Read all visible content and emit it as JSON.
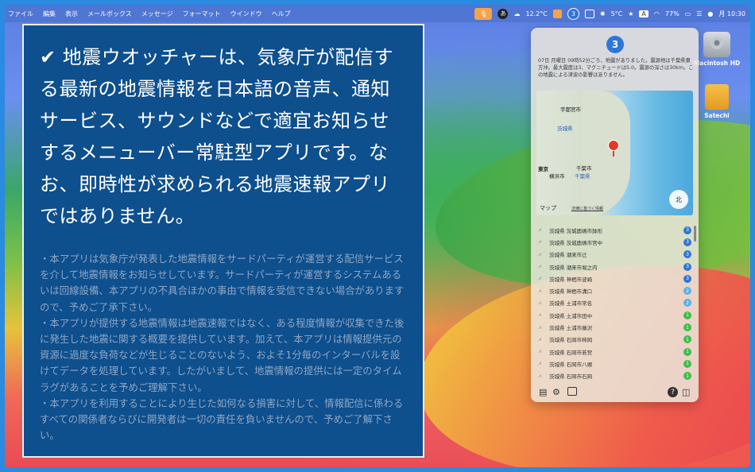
{
  "menubar": {
    "items": [
      "ファイル",
      "編集",
      "表示",
      "メールボックス",
      "メッセージ",
      "フォーマット",
      "ウインドウ",
      "ヘルプ"
    ],
    "status": {
      "dot_label": "あ",
      "weather": "12.2°C",
      "quake_level": "3",
      "temp2": "5°C",
      "input_label": "A",
      "battery": "77%",
      "clock": "月 10:30"
    }
  },
  "overlay": {
    "headline": "✔ 地震ウオッチャーは、気象庁が配信する最新の地震情報を日本語の音声、通知サービス、サウンドなどで適宜お知らせするメニューバー常駐型アプリです。なお、即時性が求められる地震速報アプリではありません。",
    "notes": "・本アプリは気象庁が発表した地震情報をサードパーティが運営する配信サービスを介して地震情報をお知らせしています。サードパーティが運営するシステムあるいは回線設備、本アプリの不具合ほかの事由で情報を受信できない場合がありますので、予めご了承下さい。\n・本アプリが提供する地震情報は地震速報ではなく、ある程度情報が収集できた後に発生した地震に関する概要を提供しています。加えて、本アプリは情報提供元の資源に過度な負荷などが生じることのないよう、およそ1分毎のインターバルを設けてデータを処理しています。したがいまして、地震情報の提供には一定のタイムラグがあることを予めご理解下さい。\n・本アプリを利用することにより生じた如何なる損害に対して、情報配信に係わるすべての関係者ならびに開発者は一切の責任を負いませんので、予めご了解下さい。"
  },
  "desktop": {
    "icons": [
      {
        "label": "Macintosh HD"
      },
      {
        "label": "Satechi"
      }
    ]
  },
  "panel": {
    "badge": "3",
    "description": "07日 月曜日 09時52分ごろ、地震がありました。震源地は千葉県東方沖。最大震度は3、マグニチュードは5.0。震源の深さは30km。この地震による津波の影響はありません。",
    "map": {
      "labels": [
        "宇都宮市",
        "茨城県",
        "東京",
        "千葉市",
        "横浜市",
        "千葉県"
      ],
      "credit": "マップ",
      "legal": "法律に基づく情報",
      "compass": "北"
    },
    "colors": {
      "level3": "#2f76d6",
      "level2": "#5ab0e6",
      "level1": "#3fbe4a"
    },
    "entries": [
      {
        "name": "茨城県 茨城鹿嶋市鉢形",
        "level": "3",
        "color": "#2f76d6"
      },
      {
        "name": "茨城県 茨城鹿嶋市宮中",
        "level": "3",
        "color": "#2f76d6"
      },
      {
        "name": "茨城県 潮来市辻",
        "level": "3",
        "color": "#2f76d6"
      },
      {
        "name": "茨城県 潮来市堀之内",
        "level": "3",
        "color": "#2f76d6"
      },
      {
        "name": "茨城県 神栖市波崎",
        "level": "3",
        "color": "#2f76d6"
      },
      {
        "name": "茨城県 神栖市溝口",
        "level": "2",
        "color": "#5ab0e6"
      },
      {
        "name": "茨城県 土浦市常名",
        "level": "2",
        "color": "#5ab0e6"
      },
      {
        "name": "茨城県 土浦市田中",
        "level": "1",
        "color": "#3fbe4a"
      },
      {
        "name": "茨城県 土浦市藤沢",
        "level": "1",
        "color": "#3fbe4a"
      },
      {
        "name": "茨城県 石岡市柿岡",
        "level": "1",
        "color": "#3fbe4a"
      },
      {
        "name": "茨城県 石岡市若宮",
        "level": "1",
        "color": "#3fbe4a"
      },
      {
        "name": "茨城県 石岡市八郷",
        "level": "1",
        "color": "#3fbe4a"
      },
      {
        "name": "茨城県 石岡市石岡",
        "level": "1",
        "color": "#3fbe4a"
      }
    ],
    "help": "?"
  }
}
